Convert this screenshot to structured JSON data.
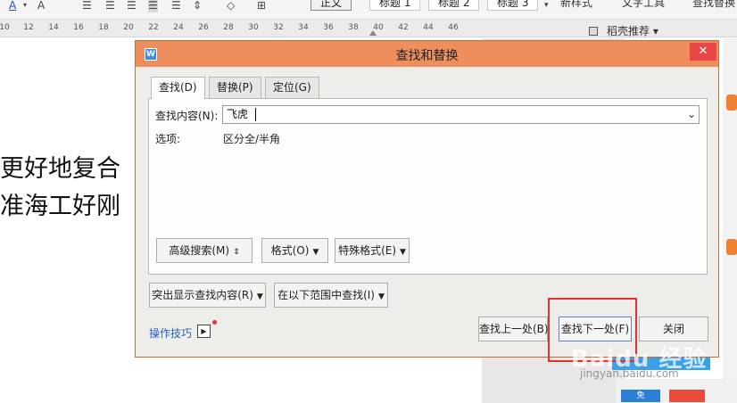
{
  "ribbon": {
    "font_color_icon": "A",
    "font_icon": "A",
    "styles": [
      "正文",
      "标题 1",
      "标题 2",
      "标题 3"
    ],
    "new_style": "新样式",
    "text_tool": "文字工具",
    "find_replace": "查找替换"
  },
  "ruler": {
    "ticks": [
      "10",
      "12",
      "14",
      "16",
      "18",
      "20",
      "22",
      "24",
      "26",
      "28",
      "30",
      "32",
      "34",
      "36",
      "38",
      "40",
      "42",
      "44",
      "46"
    ],
    "recommend": "稻壳推荐"
  },
  "document": {
    "line1": "更好地复合",
    "line2": "准海工好刚"
  },
  "dialog": {
    "title": "查找和替换",
    "close": "✕",
    "tabs": [
      "查找(D)",
      "替换(P)",
      "定位(G)"
    ],
    "find_label": "查找内容(N):",
    "find_value": "飞虎",
    "options_label": "选项:",
    "options_value": "区分全/半角",
    "buttons": {
      "advanced": "高级搜索(M)",
      "format": "格式(O)",
      "special": "特殊格式(E)",
      "highlight": "突出显示查找内容(R)",
      "find_in": "在以下范围中查找(I)",
      "find_prev": "查找上一处(B)",
      "find_next": "查找下一处(F)",
      "close": "关闭"
    },
    "tips": "操作技巧"
  },
  "side": {
    "watermark": "Baidu 经验",
    "watermark_sub": "jingyan.baidu.com",
    "thumb": "免"
  },
  "colors": {
    "titlebar": "#ee8e5c",
    "close": "#e94646",
    "highlight": "#e03030",
    "link": "#2b5fc4"
  }
}
